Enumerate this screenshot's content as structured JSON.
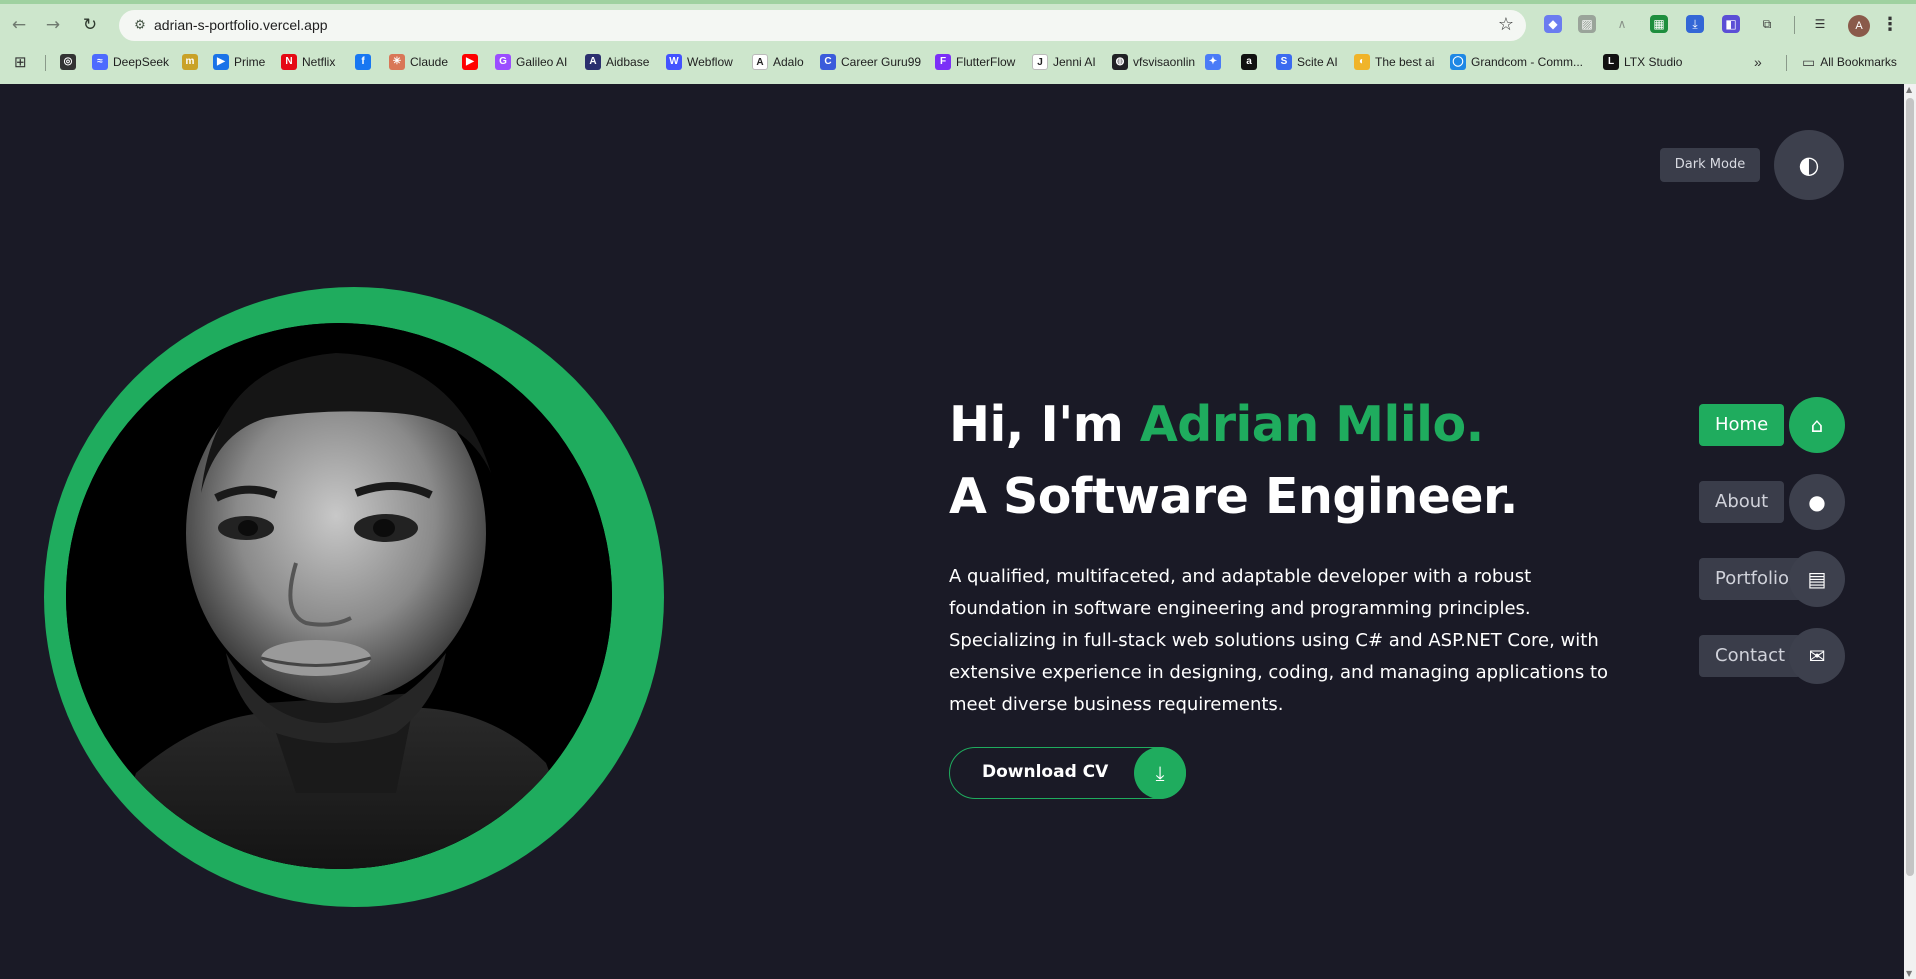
{
  "browser": {
    "url": "adrian-s-portfolio.vercel.app",
    "profile_initial": "A",
    "bookmarks": [
      {
        "label": "",
        "icon": "openai-icon",
        "color": "#333333",
        "glyph": "◎"
      },
      {
        "label": "DeepSeek",
        "icon": "deepseek-icon",
        "color": "#4d6bfe",
        "glyph": "≈"
      },
      {
        "label": "",
        "icon": "huggingface-icon",
        "color": "#c9a227",
        "glyph": "m"
      },
      {
        "label": "Prime",
        "icon": "prime-icon",
        "color": "#1a73e8",
        "glyph": "▶"
      },
      {
        "label": "Netflix",
        "icon": "netflix-icon",
        "color": "#e50914",
        "glyph": "N"
      },
      {
        "label": "",
        "icon": "facebook-icon",
        "color": "#1877f2",
        "glyph": "f"
      },
      {
        "label": "Claude",
        "icon": "claude-icon",
        "color": "#d97757",
        "glyph": "✳"
      },
      {
        "label": "",
        "icon": "youtube-icon",
        "color": "#ff0000",
        "glyph": "▶"
      },
      {
        "label": "Galileo AI",
        "icon": "galileo-icon",
        "color": "#9b4dff",
        "glyph": "G"
      },
      {
        "label": "Aidbase",
        "icon": "aidbase-icon",
        "color": "#2a2f6e",
        "glyph": "A"
      },
      {
        "label": "Webflow",
        "icon": "webflow-icon",
        "color": "#4353ff",
        "glyph": "W"
      },
      {
        "label": "Adalo",
        "icon": "adalo-icon",
        "color": "#ffffff",
        "glyph": "A"
      },
      {
        "label": "Career Guru99",
        "icon": "guru99-icon",
        "color": "#3b5bdb",
        "glyph": "C"
      },
      {
        "label": "FlutterFlow",
        "icon": "flutterflow-icon",
        "color": "#7b2ff7",
        "glyph": "F"
      },
      {
        "label": "Jenni AI",
        "icon": "jenni-icon",
        "color": "#ffffff",
        "glyph": "J"
      },
      {
        "label": "vfsvisaonlin",
        "icon": "globe-icon",
        "color": "#202124",
        "glyph": "◍"
      },
      {
        "label": "",
        "icon": "gemini-icon",
        "color": "#4a7bf7",
        "glyph": "✦"
      },
      {
        "label": "",
        "icon": "aws-icon",
        "color": "#111111",
        "glyph": "a"
      },
      {
        "label": "Scite AI",
        "icon": "scite-icon",
        "color": "#3b6bf0",
        "glyph": "S"
      },
      {
        "label": "The best ai",
        "icon": "bestai-icon",
        "color": "#f0b429",
        "glyph": "◐"
      },
      {
        "label": "Grandcom - Comm...",
        "icon": "chat-icon",
        "color": "#1e88e5",
        "glyph": "◯"
      },
      {
        "label": "LTX Studio",
        "icon": "ltx-icon",
        "color": "#111111",
        "glyph": "L"
      }
    ],
    "all_bookmarks_label": "All Bookmarks"
  },
  "page": {
    "dark_mode_label": "Dark Mode",
    "hero": {
      "greeting": "Hi, I'm ",
      "name": "Adrian Mlilo.",
      "role": "A Software Engineer.",
      "description": "A qualified, multifaceted, and adaptable developer with a robust foundation in software engineering and programming principles. Specializing in full-stack web solutions using C# and ASP.NET Core, with extensive experience in designing, coding, and managing applications to meet diverse business requirements.",
      "cv_button": "Download CV"
    },
    "nav": [
      {
        "label": "Home",
        "icon": "home-icon",
        "active": true
      },
      {
        "label": "About",
        "icon": "user-icon",
        "active": false
      },
      {
        "label": "Portfolio",
        "icon": "briefcase-icon",
        "active": false
      },
      {
        "label": "Contact",
        "icon": "envelope-icon",
        "active": false
      }
    ]
  },
  "colors": {
    "accent": "#1fac5e",
    "background": "#1a1a26",
    "nav_inactive": "#3a3d4a"
  }
}
